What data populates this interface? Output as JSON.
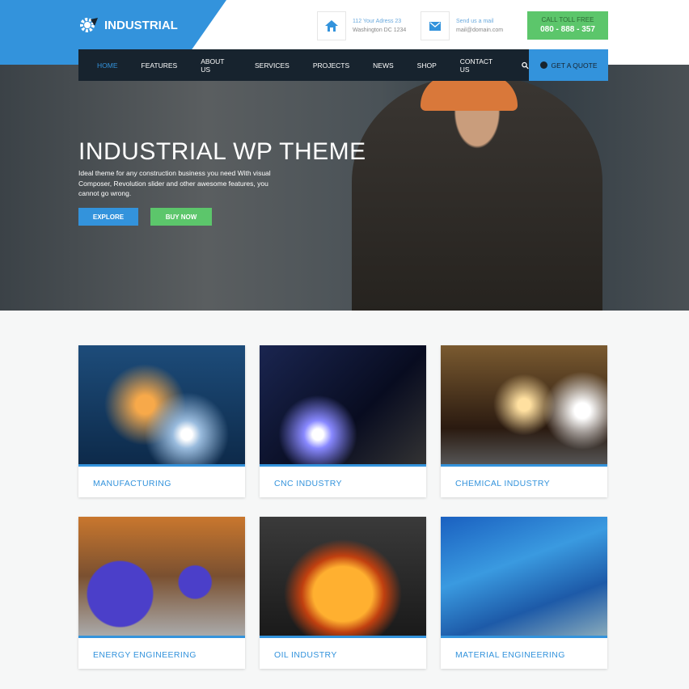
{
  "brand": {
    "name": "INDUSTRIAL",
    "accent": "#3393dc",
    "green": "#5cc66b",
    "dark": "#17232e"
  },
  "header": {
    "address": {
      "icon": "home-icon",
      "line1": "112 Your Adress 23",
      "line2": "Washington DC 1234"
    },
    "mail": {
      "icon": "envelope-icon",
      "line1": "Send us a mail",
      "line2": "mail@domain.com"
    },
    "call": {
      "label": "CALL TOLL FREE",
      "number": "080 - 888 - 357"
    }
  },
  "nav": {
    "items": [
      "HOME",
      "FEATURES",
      "ABOUT US",
      "SERVICES",
      "PROJECTS",
      "NEWS",
      "SHOP",
      "CONTACT US"
    ],
    "active": "HOME",
    "quote": "GET A QUOTE"
  },
  "hero": {
    "title": "INDUSTRIAL WP THEME",
    "subtitle": "Ideal theme for any construction business you need With visual Composer, Revolution slider and other awesome features, you cannot go wrong.",
    "explore": "EXPLORE",
    "buy": "BUY NOW"
  },
  "cards": [
    "MANUFACTURING",
    "CNC INDUSTRY",
    "CHEMICAL INDUSTRY",
    "ENERGY ENGINEERING",
    "OIL INDUSTRY",
    "MATERIAL ENGINEERING"
  ]
}
